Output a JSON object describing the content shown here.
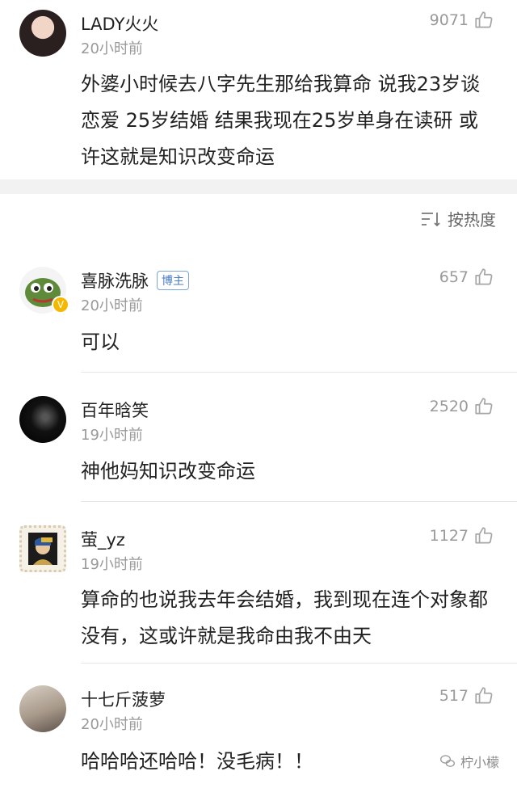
{
  "sort": {
    "label": "按热度"
  },
  "comments": [
    {
      "name": "LADY火火",
      "time": "20小时前",
      "likes": "9071",
      "text": "外婆小时候去八字先生那给我算命 说我23岁谈恋爱 25岁结婚 结果我现在25岁单身在读研  或许这就是知识改变命运"
    },
    {
      "name": "喜脉洗脉",
      "badge": "博主",
      "time": "20小时前",
      "likes": "657",
      "text": "可以"
    },
    {
      "name": "百年晗笑",
      "time": "19小时前",
      "likes": "2520",
      "text": "神他妈知识改变命运"
    },
    {
      "name": "萤_yz",
      "time": "19小时前",
      "likes": "1127",
      "text": "算命的也说我去年会结婚，我到现在连个对象都没有，这或许就是我命由我不由天"
    },
    {
      "name": "十七斤菠萝",
      "time": "20小时前",
      "likes": "517",
      "text": "哈哈哈还哈哈！没毛病！！"
    }
  ],
  "watermark": {
    "text": "柠小檬"
  }
}
